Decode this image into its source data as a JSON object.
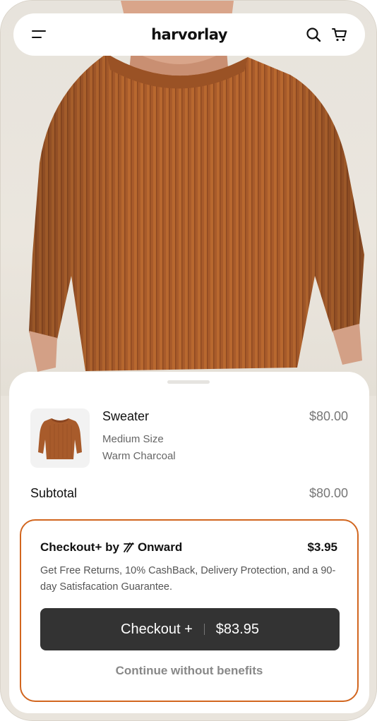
{
  "header": {
    "brand": "harvorlay"
  },
  "product": {
    "name": "Sweater",
    "price": "$80.00",
    "size": "Medium Size",
    "color": "Warm Charcoal"
  },
  "summary": {
    "subtotal_label": "Subtotal",
    "subtotal_value": "$80.00"
  },
  "offer": {
    "title_prefix": "Checkout+ by",
    "provider": "Onward",
    "price": "$3.95",
    "description": "Get Free Returns, 10% CashBack, Delivery Protection, and a 90-day Satisfacation Guarantee.",
    "checkout_label": "Checkout +",
    "checkout_total": "$83.95",
    "continue_label": "Continue without benefits"
  },
  "colors": {
    "accent_border": "#d2661f",
    "button_bg": "#333333",
    "sweater": "#a65a2a"
  },
  "icons": [
    "menu-icon",
    "search-icon",
    "cart-icon",
    "onward-logo-icon"
  ]
}
